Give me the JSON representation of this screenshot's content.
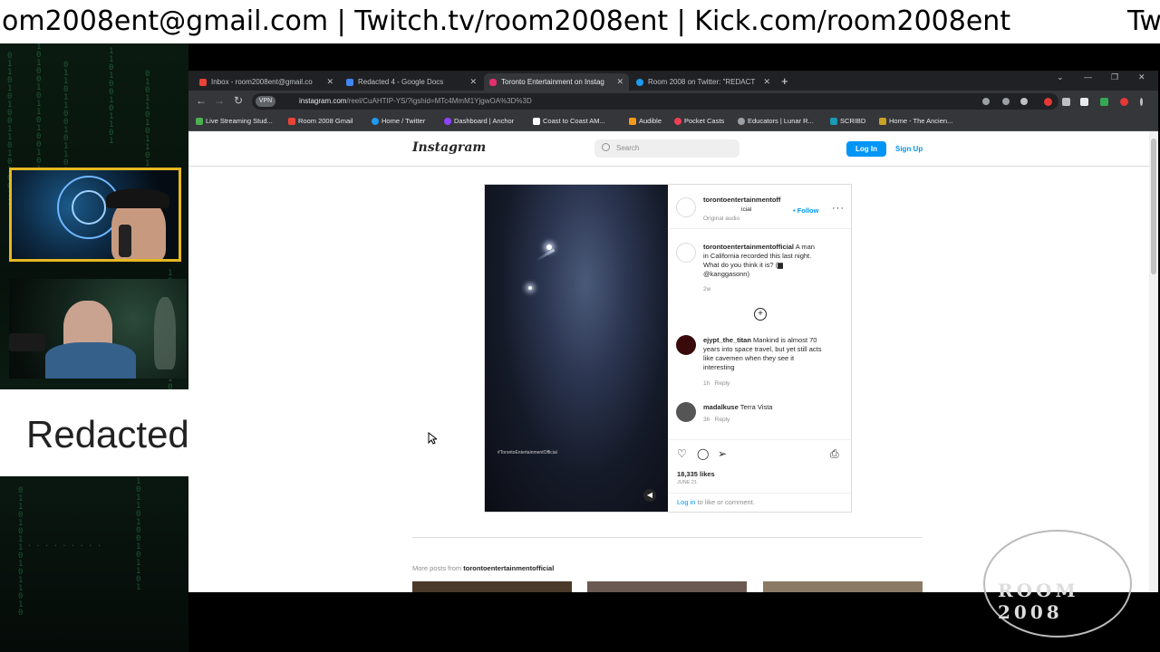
{
  "ticker": {
    "text_main": "om2008ent@gmail.com | Twitch.tv/room2008ent | Kick.com/room2008ent",
    "text_tail": "Tw"
  },
  "overlay": {
    "redacted_label": "Redacted",
    "bottom_brand": "ROOM 2008"
  },
  "browser": {
    "tabs": [
      {
        "label": "Inbox - room2008ent@gmail.co",
        "icon": "gmail-icon",
        "color": "#ea4335"
      },
      {
        "label": "Redacted 4 - Google Docs",
        "icon": "docs-icon",
        "color": "#4285f4"
      },
      {
        "label": "Toronto Entertainment on Instag",
        "icon": "instagram-icon",
        "color": "#e1306c"
      },
      {
        "label": "Room 2008 on Twitter: \"REDACT",
        "icon": "twitter-icon",
        "color": "#1d9bf0"
      }
    ],
    "vpn_badge": "VPN",
    "url_host": "instagram.com",
    "url_path": "/reel/CuAHTIP-YS/?igshid=MTc4MmM1YjgwOA%3D%3D",
    "bookmarks": [
      "Live Streaming Stud...",
      "Room 2008 Gmail",
      "Home / Twitter",
      "Dashboard | Anchor",
      "Coast to Coast AM...",
      "Audible",
      "Pocket Casts",
      "Educators | Lunar R...",
      "SCRIBD",
      "Home - The Ancien..."
    ]
  },
  "instagram": {
    "logo": "Instagram",
    "search_placeholder": "Search",
    "login_label": "Log In",
    "signup_label": "Sign Up",
    "post": {
      "username": "torontoentertainmentoff",
      "username_cont": "icial",
      "audio": "Original audio",
      "follow_label": "Follow",
      "video_caption": "#TorontoEntertainmentOfficial",
      "caption_user": "torontoentertainmentofficial",
      "caption_text_1": "A man",
      "caption_text_2": "in California recorded this last night.",
      "caption_text_3": "What do you think it is? (",
      "caption_credit": "@kanggasonn)",
      "caption_age": "2w",
      "comments": [
        {
          "user": "ejypt_the_titan",
          "lines": [
            "Mankind is almost 70",
            "years into space travel, but yet still acts",
            "like cavemen when they see it",
            "interesting"
          ],
          "age": "1h",
          "reply": "Reply"
        },
        {
          "user": "madalkuse",
          "lines": [
            "Terra Vista"
          ],
          "age": "3h",
          "reply": "Reply"
        }
      ],
      "likes": "18,335 likes",
      "date": "JUNE 21",
      "login_prompt_link": "Log in",
      "login_prompt_rest": "to like or comment."
    },
    "more_posts_prefix": "More posts from",
    "more_posts_user": "torontoentertainmentofficial"
  }
}
